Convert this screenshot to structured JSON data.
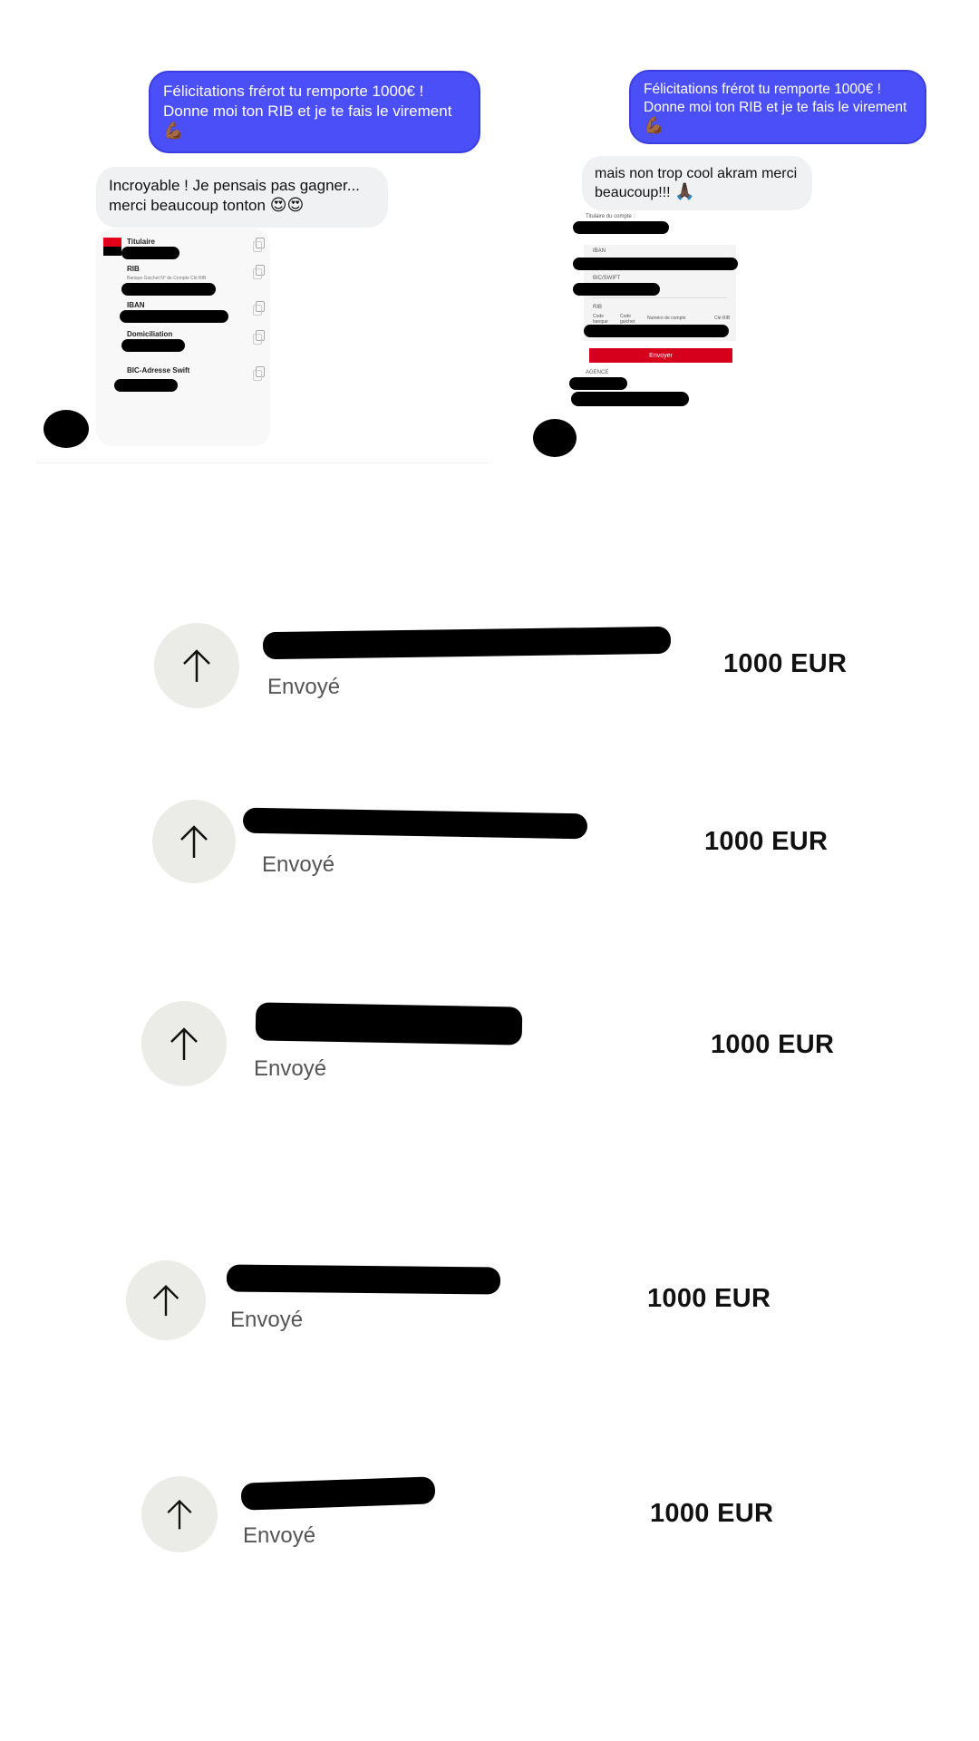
{
  "left_chat": {
    "outgoing_line1": "Félicitations frérot tu remporte 1000€ !",
    "outgoing_line2": "Donne moi ton RIB et je te fais le virement",
    "outgoing_emoji": "💪🏾",
    "incoming_line1": "Incroyable ! Je pensais pas gagner...",
    "incoming_line2": "merci beaucoup tonton",
    "incoming_emoji": "😍😍",
    "rib": {
      "titulaire": "Titulaire",
      "rib": "RIB",
      "rib_sub": "Banque  Guichet  N° de Compte  Clé RIB",
      "iban": "IBAN",
      "domiciliation": "Domiciliation",
      "bic": "BIC-Adresse Swift"
    }
  },
  "right_chat": {
    "outgoing_line1": "Félicitations frérot tu remporte 1000€ !",
    "outgoing_line2": "Donne moi ton RIB et je te fais le virement",
    "outgoing_emoji": "💪🏾",
    "incoming_line1": "mais non trop cool akram merci",
    "incoming_line2": "beaucoup!!!",
    "incoming_emoji": "🙏🏿",
    "form": {
      "titulaire": "Titulaire du compte :",
      "iban": "IBAN",
      "bic": "BIC/SWIFT",
      "rib": "RIB",
      "code_banque": "Code banque",
      "code_guichet": "Code guichet",
      "numero_compte": "Numéro de compte",
      "cle_rib": "Clé RIB",
      "send": "Envoyer",
      "agence": "AGENCE"
    }
  },
  "transactions": [
    {
      "status": "Envoyé",
      "amount": "1000 EUR",
      "icon": "arrow-up-icon"
    },
    {
      "status": "Envoyé",
      "amount": "1000 EUR",
      "icon": "arrow-up-icon"
    },
    {
      "status": "Envoyé",
      "amount": "1000 EUR",
      "icon": "arrow-up-icon"
    },
    {
      "status": "Envoyé",
      "amount": "1000 EUR",
      "icon": "arrow-up-icon"
    },
    {
      "status": "Envoyé",
      "amount": "1000 EUR",
      "icon": "arrow-up-icon"
    }
  ],
  "colors": {
    "bubble_out": "#4b4ff7",
    "bubble_in": "#f0f1f3",
    "icon_bg": "#ebebe7",
    "send_button": "#d6001c"
  }
}
